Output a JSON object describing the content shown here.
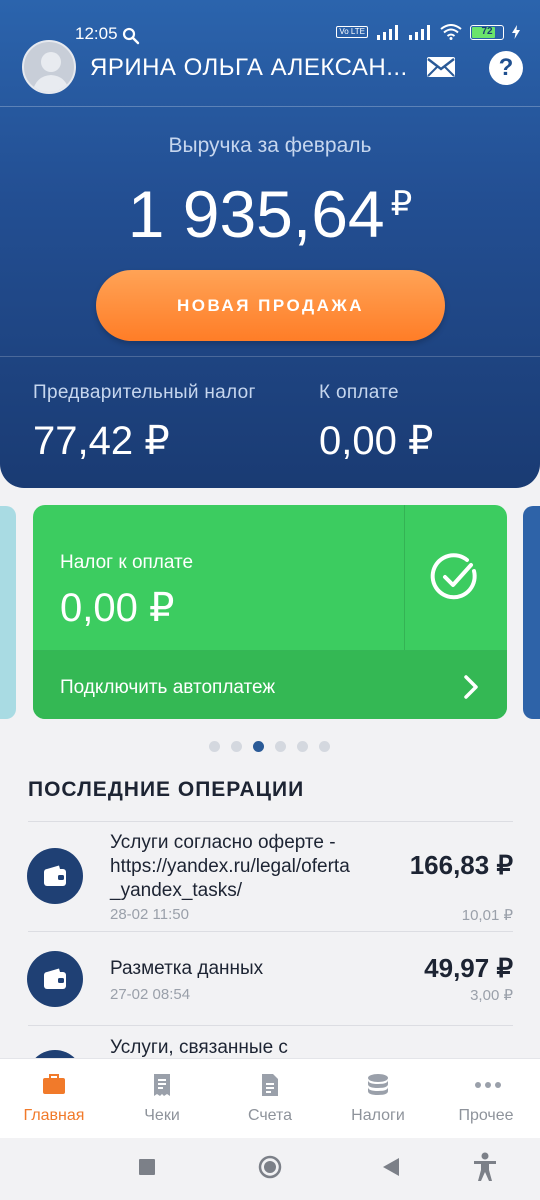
{
  "status_bar": {
    "time": "12:05",
    "volte": "Vo LTE",
    "battery": "72"
  },
  "header": {
    "user_name": "ЯРИНА ОЛЬГА АЛЕКСАН...",
    "revenue_label": "Выручка за февраль",
    "revenue_value": "1 935,64",
    "currency": "₽",
    "new_sale_label": "НОВАЯ ПРОДАЖА",
    "prelim_tax_label": "Предварительный налог",
    "prelim_tax_value": "77,42 ₽",
    "to_pay_label": "К оплате",
    "to_pay_value": "0,00 ₽"
  },
  "tax_card": {
    "label": "Налог к оплате",
    "value": "0,00 ₽",
    "autopay_label": "Подключить автоплатеж"
  },
  "carousel": {
    "count": 6,
    "active_index": 2
  },
  "operations": {
    "title": "ПОСЛЕДНИЕ ОПЕРАЦИИ",
    "items": [
      {
        "name": "Услуги согласно оферте - https://yandex.ru/legal/oferta _yandex_tasks/",
        "date": "28-02 11:50",
        "amount": "166,83 ₽",
        "fee": "10,01 ₽"
      },
      {
        "name": "Разметка данных",
        "date": "27-02 08:54",
        "amount": "49,97 ₽",
        "fee": "3,00 ₽"
      },
      {
        "name": "Услуги, связанные с"
      }
    ]
  },
  "nav": {
    "items": [
      {
        "label": "Главная",
        "icon": "briefcase-icon",
        "active": true
      },
      {
        "label": "Чеки",
        "icon": "receipt-icon"
      },
      {
        "label": "Счета",
        "icon": "document-icon"
      },
      {
        "label": "Налоги",
        "icon": "coins-icon"
      },
      {
        "label": "Прочее",
        "icon": "more-icon"
      }
    ]
  },
  "colors": {
    "accent": "#f17a2a",
    "header_blue": "#234f93",
    "green": "#3ccc60",
    "dark_blue": "#1f4074"
  }
}
